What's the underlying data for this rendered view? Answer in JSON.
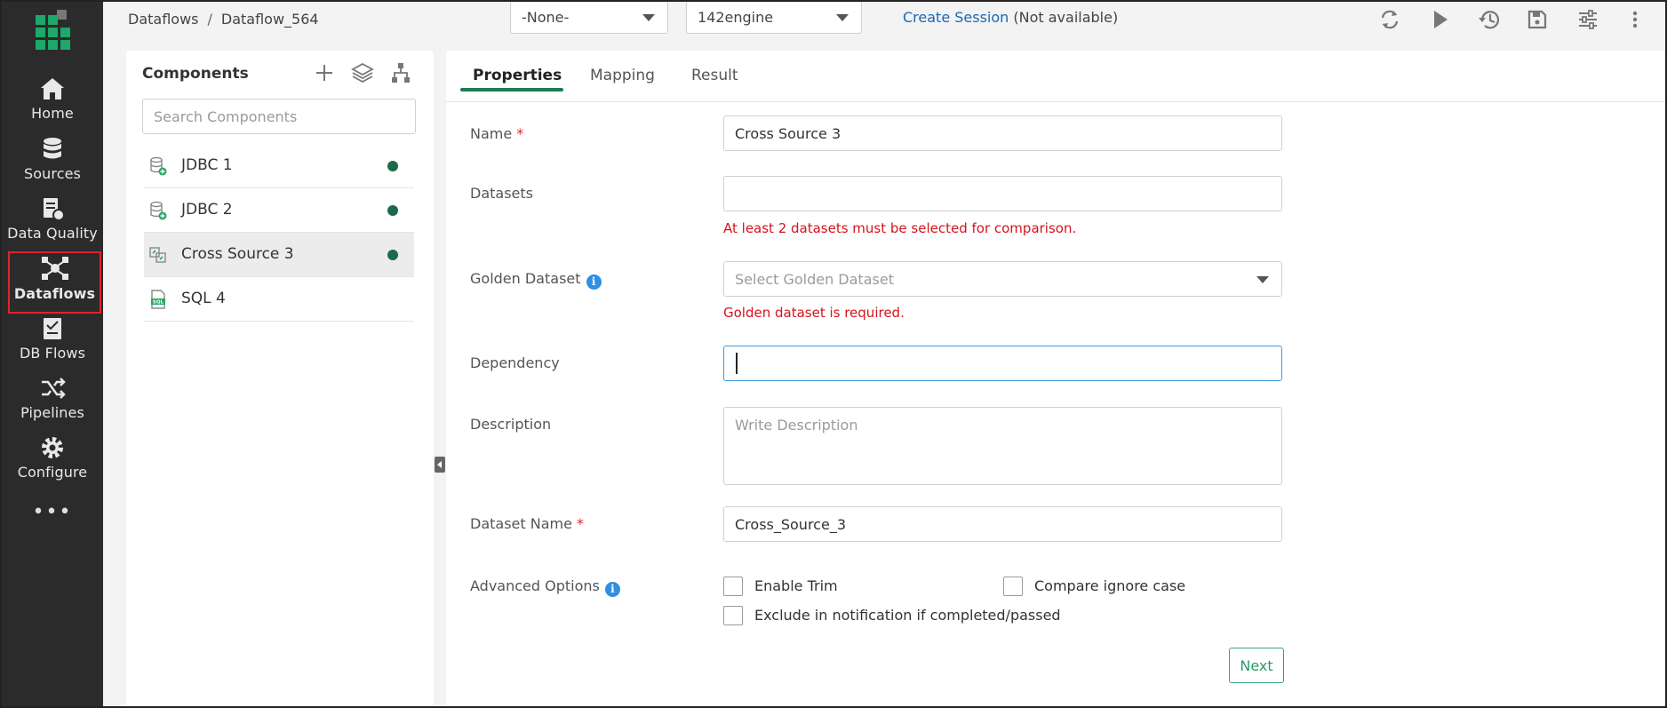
{
  "sidebar": {
    "items": [
      {
        "label": "Home",
        "icon": "home-icon"
      },
      {
        "label": "Sources",
        "icon": "database-icon"
      },
      {
        "label": "Data Quality",
        "icon": "data-quality-icon"
      },
      {
        "label": "Dataflows",
        "icon": "dataflows-icon",
        "active": true
      },
      {
        "label": "DB Flows",
        "icon": "db-flows-icon"
      },
      {
        "label": "Pipelines",
        "icon": "pipelines-icon"
      },
      {
        "label": "Configure",
        "icon": "gear-icon"
      }
    ],
    "more": "•••"
  },
  "header": {
    "breadcrumb": [
      "Dataflows",
      "Dataflow_564"
    ],
    "breadcrumb_sep": "/",
    "environment_select": "-None-",
    "engine_select": "142engine",
    "create_session_link": "Create Session",
    "session_status": "(Not available)",
    "toolbar_icons": [
      "refresh-icon",
      "play-icon",
      "history-icon",
      "save-icon",
      "settings-sliders-icon",
      "more-vertical-icon"
    ]
  },
  "components": {
    "title": "Components",
    "tool_icons": [
      "add-icon",
      "layers-icon",
      "hierarchy-icon"
    ],
    "search_placeholder": "Search Components",
    "items": [
      {
        "label": "JDBC 1",
        "icon": "jdbc-icon",
        "status_color": "#1b6b4a"
      },
      {
        "label": "JDBC 2",
        "icon": "jdbc-icon",
        "status_color": "#1b6b4a"
      },
      {
        "label": "Cross Source 3",
        "icon": "cross-source-icon",
        "status_color": "#1b6b4a",
        "selected": true
      },
      {
        "label": "SQL 4",
        "icon": "sql-icon"
      }
    ]
  },
  "tabs": {
    "properties": "Properties",
    "mapping": "Mapping",
    "result": "Result",
    "active": "Properties"
  },
  "form": {
    "name_label": "Name",
    "required_mark": "*",
    "name_value": "Cross Source 3",
    "datasets_label": "Datasets",
    "datasets_error": "At least 2 datasets must be selected for comparison.",
    "golden_label": "Golden Dataset",
    "golden_placeholder": "Select Golden Dataset",
    "golden_error": "Golden dataset is required.",
    "dependency_label": "Dependency",
    "description_label": "Description",
    "description_placeholder": "Write Description",
    "dataset_name_label": "Dataset Name",
    "dataset_name_value": "Cross_Source_3",
    "advanced_label": "Advanced Options",
    "enable_trim": "Enable Trim",
    "compare_ignore_case": "Compare ignore case",
    "exclude_notification": "Exclude in notification if completed/passed",
    "next_button": "Next"
  },
  "colors": {
    "sidebar_bg": "#2b2b2b",
    "accent_green": "#1d7a54",
    "link_blue": "#1a68b6",
    "error_red": "#d3141c",
    "info_blue": "#2f8fe0"
  }
}
